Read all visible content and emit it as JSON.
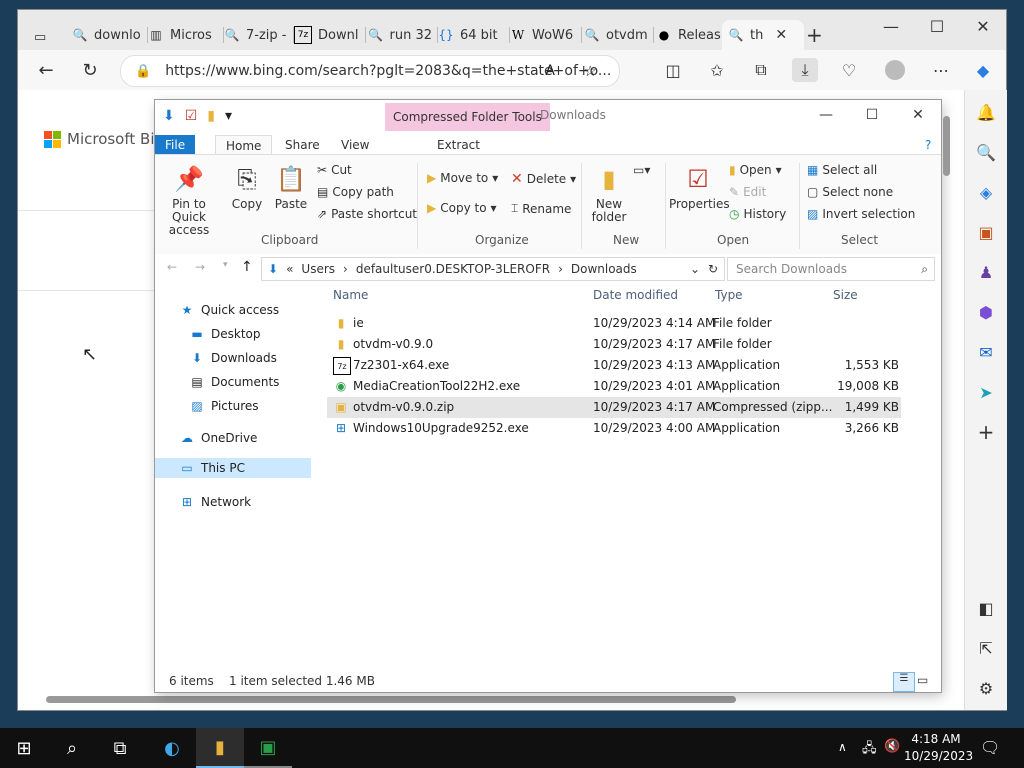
{
  "browser": {
    "tabs": [
      {
        "label": "downlo",
        "icon": "search-icon"
      },
      {
        "label": "Micros",
        "icon": "library-icon"
      },
      {
        "label": "7-zip -",
        "icon": "search-icon"
      },
      {
        "label": "Downl",
        "icon": "7zip-icon"
      },
      {
        "label": "run 32",
        "icon": "search-icon"
      },
      {
        "label": "64 bit",
        "icon": "code-icon"
      },
      {
        "label": "WoW6",
        "icon": "wikipedia-icon"
      },
      {
        "label": "otvdm",
        "icon": "search-icon"
      },
      {
        "label": "Releas",
        "icon": "github-icon"
      },
      {
        "label": "th",
        "icon": "search-icon"
      }
    ],
    "url": "https://www.bing.com/search?pglt=2083&q=the+state+of+o...",
    "page_logo": "Microsoft Bing"
  },
  "explorer": {
    "context_tab": "Compressed Folder Tools",
    "title": "Downloads",
    "ribbon_tabs": [
      "File",
      "Home",
      "Share",
      "View",
      "Extract"
    ],
    "ribbon": {
      "pin": "Pin to Quick access",
      "copy": "Copy",
      "paste": "Paste",
      "cut": "Cut",
      "copy_path": "Copy path",
      "paste_shortcut": "Paste shortcut",
      "clipboard": "Clipboard",
      "move_to": "Move to",
      "copy_to": "Copy to",
      "delete": "Delete",
      "rename": "Rename",
      "organize": "Organize",
      "new_folder": "New folder",
      "new": "New",
      "properties": "Properties",
      "open_menu": "Open",
      "edit": "Edit",
      "history": "History",
      "open": "Open",
      "select_all": "Select all",
      "select_none": "Select none",
      "invert": "Invert selection",
      "select": "Select"
    },
    "breadcrumb": [
      "Users",
      "defaultuser0.DESKTOP-3LEROFR",
      "Downloads"
    ],
    "search_placeholder": "Search Downloads",
    "nav": [
      {
        "label": "Quick access",
        "icon": "star-icon"
      },
      {
        "label": "Desktop",
        "icon": "desktop-icon"
      },
      {
        "label": "Downloads",
        "icon": "download-icon"
      },
      {
        "label": "Documents",
        "icon": "document-icon"
      },
      {
        "label": "Pictures",
        "icon": "picture-icon"
      },
      {
        "label": "OneDrive",
        "icon": "cloud-icon"
      },
      {
        "label": "This PC",
        "icon": "computer-icon"
      },
      {
        "label": "Network",
        "icon": "network-icon"
      }
    ],
    "columns": [
      "Name",
      "Date modified",
      "Type",
      "Size"
    ],
    "files": [
      {
        "name": "ie",
        "date": "10/29/2023 4:14 AM",
        "type": "File folder",
        "size": ""
      },
      {
        "name": "otvdm-v0.9.0",
        "date": "10/29/2023 4:17 AM",
        "type": "File folder",
        "size": ""
      },
      {
        "name": "7z2301-x64.exe",
        "date": "10/29/2023 4:13 AM",
        "type": "Application",
        "size": "1,553 KB"
      },
      {
        "name": "MediaCreationTool22H2.exe",
        "date": "10/29/2023 4:01 AM",
        "type": "Application",
        "size": "19,008 KB"
      },
      {
        "name": "otvdm-v0.9.0.zip",
        "date": "10/29/2023 4:17 AM",
        "type": "Compressed (zipp...",
        "size": "1,499 KB"
      },
      {
        "name": "Windows10Upgrade9252.exe",
        "date": "10/29/2023 4:00 AM",
        "type": "Application",
        "size": "3,266 KB"
      }
    ],
    "status_count": "6 items",
    "status_selected": "1 item selected  1.46 MB"
  },
  "taskbar": {
    "time": "4:18 AM",
    "date": "10/29/2023"
  }
}
